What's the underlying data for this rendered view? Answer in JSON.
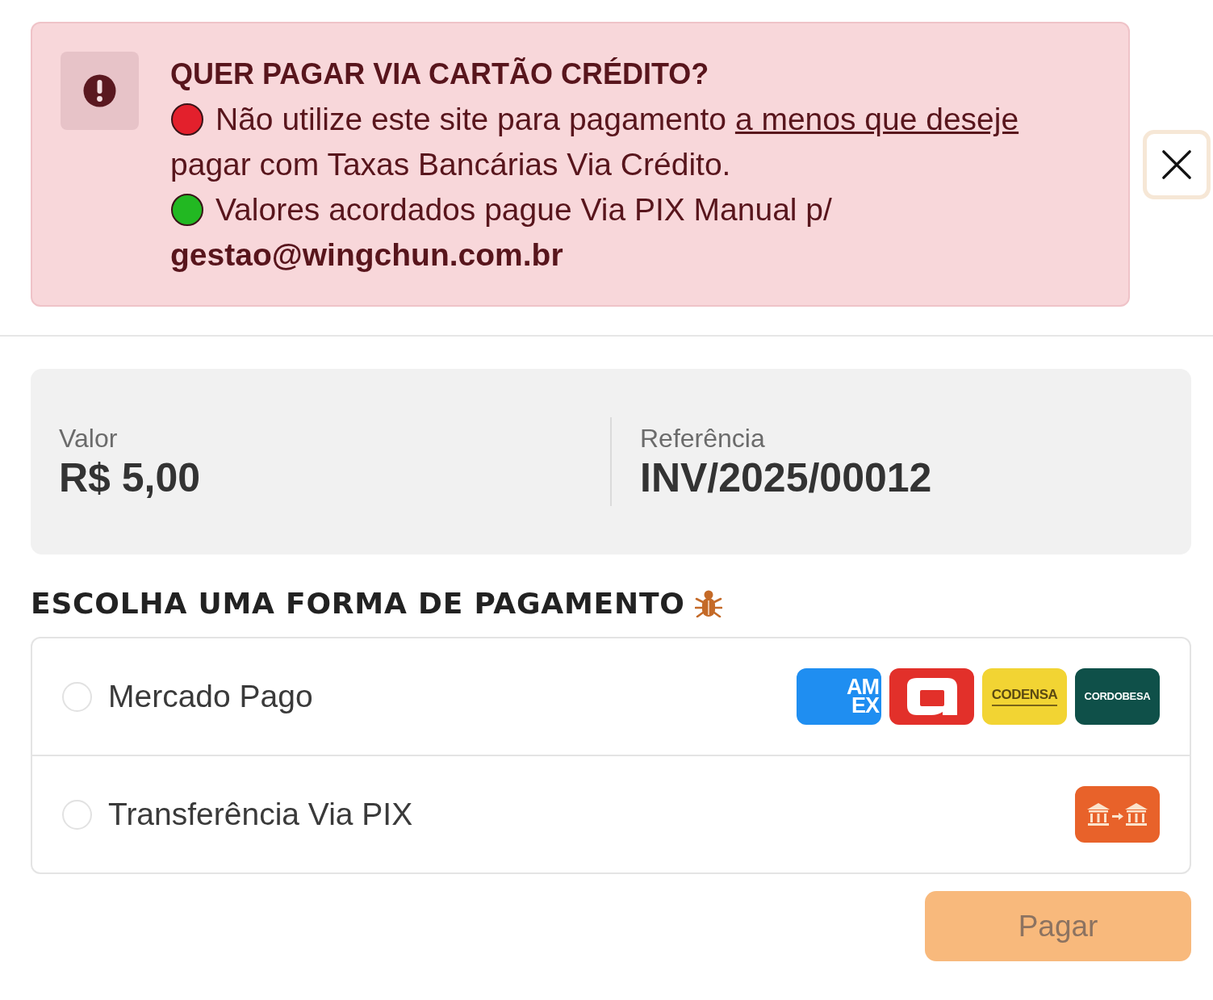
{
  "alert": {
    "title": "QUER PAGAR VIA CARTÃO CRÉDITO?",
    "items": [
      {
        "color": "#e3202c",
        "text": "Não utilize este site para pagamento",
        "link": "a menos que deseje",
        "text_after": "pagar com Taxas Bancárias Via Crédito."
      },
      {
        "color": "#22b822",
        "text": "Valores acordados pague Via PIX Manual p/ **gestao@wingchun.com.br**"
      }
    ]
  },
  "summary": {
    "fields": [
      {
        "label": "Valor",
        "value": "R$ 5,00"
      },
      {
        "label": "Referência",
        "value": "INV/2025/00012"
      }
    ]
  },
  "payment": {
    "heading": "ESCOLHA UMA FORMA DE PAGAMENTO",
    "options": [
      {
        "label": "Mercado Pago",
        "selected": false,
        "logos": [
          {
            "kind": "stacked_wordmark",
            "lines": [
              "AM",
              "EX"
            ],
            "color": "#1f8ef1"
          },
          {
            "kind": "symbol",
            "color": "#e2302a"
          },
          {
            "kind": "ruled_wordmark",
            "lines": [
              "CODENSA"
            ],
            "color": "#f2d433"
          },
          {
            "kind": "wordmark",
            "lines": [
              "CORDOBESA"
            ],
            "color": "#0f5049"
          }
        ]
      },
      {
        "label": "Transferência Via PIX",
        "selected": false,
        "logos": [
          {
            "kind": "bank_transfer",
            "color": "#e8622a"
          }
        ]
      }
    ]
  },
  "pay_button": {
    "label": "Pagar",
    "disabled": true
  }
}
